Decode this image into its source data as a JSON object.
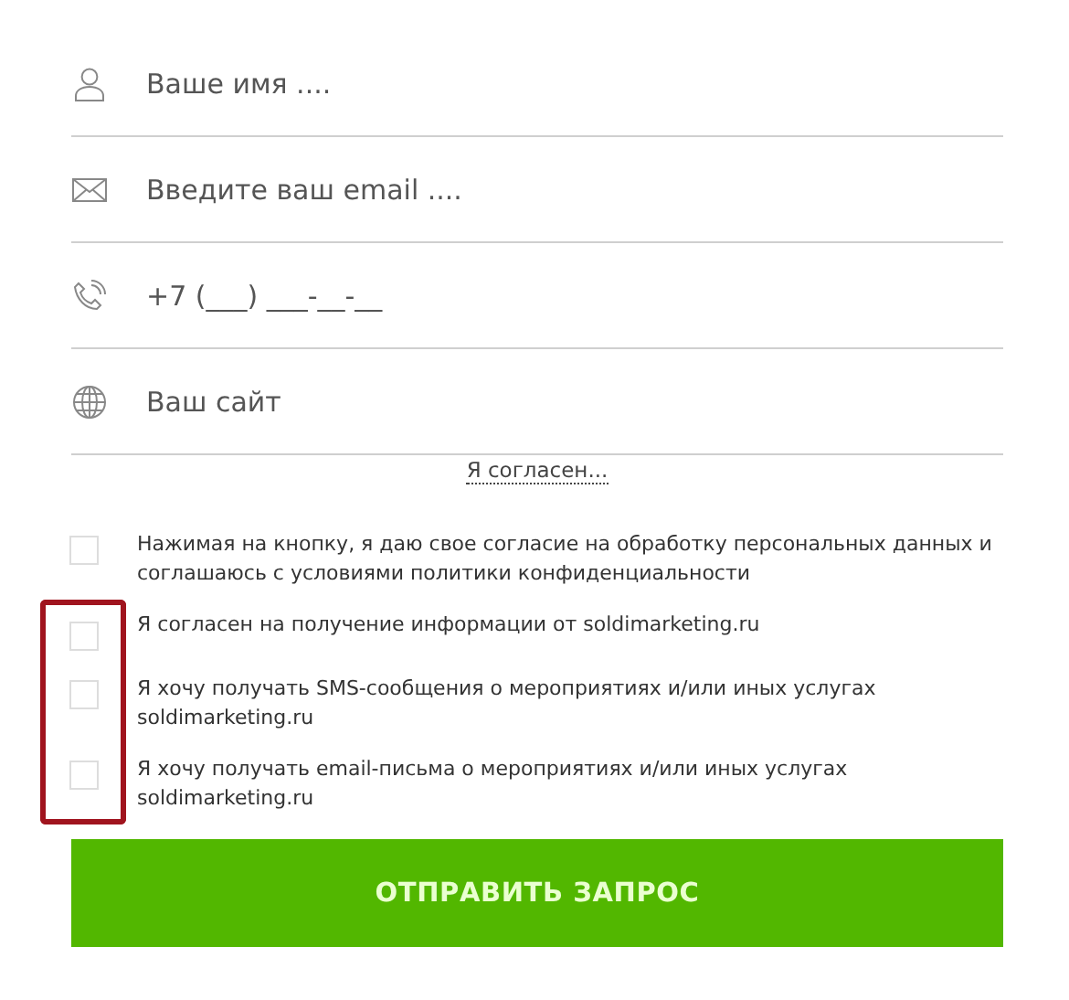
{
  "fields": [
    {
      "kind": "person",
      "placeholder": "Ваше имя ...."
    },
    {
      "kind": "mail",
      "placeholder": "Введите ваш email ...."
    },
    {
      "kind": "phone",
      "placeholder": "+7 (___) ___-__-__"
    },
    {
      "kind": "globe",
      "placeholder": "Ваш сайт"
    }
  ],
  "consent_link": "Я согласен...",
  "checkboxes": [
    {
      "label": "Нажимая на кнопку, я даю свое согласие на обработку персональных данных и соглашаюсь с условиями политики конфиденциальности",
      "checked": false,
      "marked": false
    },
    {
      "label": "Я согласен на получение информации от soldimarketing.ru",
      "checked": false,
      "marked": true
    },
    {
      "label": "Я хочу получать SMS-сообщения о мероприятиях и/или иных услугах soldimarketing.ru",
      "checked": false,
      "marked": true
    },
    {
      "label": "Я хочу получать email-письма о мероприятиях и/или иных услугах soldimarketing.ru",
      "checked": false,
      "marked": true
    }
  ],
  "submit_button": "ОТПРАВИТЬ ЗАПРОС"
}
